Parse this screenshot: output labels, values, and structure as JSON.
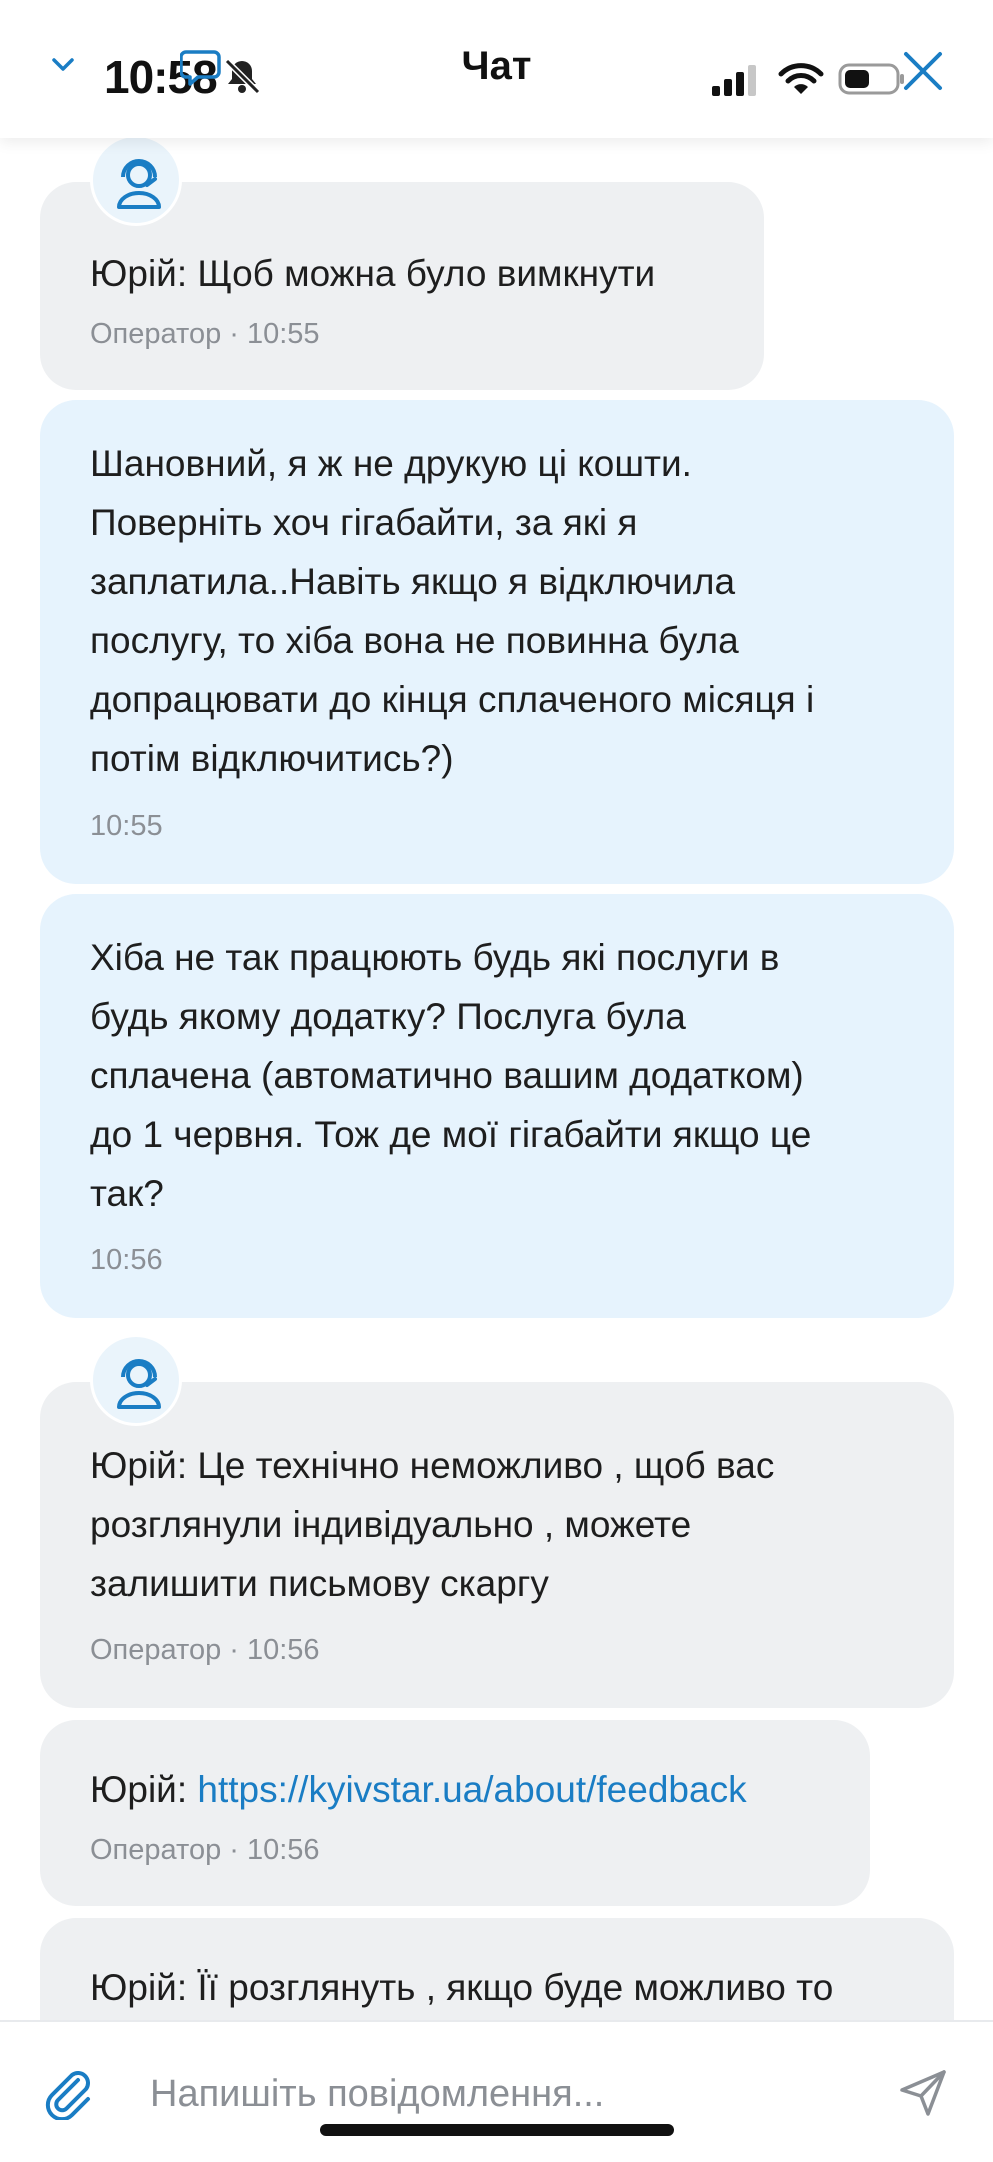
{
  "status_bar": {
    "time": "10:58"
  },
  "header": {
    "title": "Чат"
  },
  "messages": [
    {
      "kind": "operator",
      "author": "Юрій:",
      "text": "Щоб можна було вимкнути",
      "meta": "Оператор · 10:55"
    },
    {
      "kind": "user",
      "lines": [
        "Шановний, я ж не друкую ці кошти.",
        "Поверніть хоч гігабайти, за які я",
        "заплатила..Навіть якщо я відключила",
        "послугу, то хіба вона не повинна була",
        "допрацювати до кінця сплаченого місяця і",
        "потім відключитись?)"
      ],
      "meta": "10:55"
    },
    {
      "kind": "user",
      "lines": [
        "Хіба не так працюють будь які послуги в",
        "будь якому додатку? Послуга була",
        "сплачена (автоматично вашим додатком)",
        "до 1 червня. Тож де мої гігабайти якщо це",
        "так?"
      ],
      "meta": "10:56"
    },
    {
      "kind": "operator",
      "author": "Юрій:",
      "lines": [
        "Юрій: Це технічно неможливо , щоб вас",
        "розглянули індивідуально , можете",
        "залишити письмову скаргу"
      ],
      "meta": "Оператор · 10:56"
    },
    {
      "kind": "operator",
      "author": "Юрій:",
      "link": "https://kyivstar.ua/about/feedback",
      "meta": "Оператор · 10:56"
    },
    {
      "kind": "operator",
      "author": "Юрій:",
      "text": "Юрій: Її розглянуть , якщо буде можливо то"
    }
  ],
  "composer": {
    "placeholder": "Напишіть повідомлення..."
  },
  "colors": {
    "accent": "#1a7dc4",
    "operator_bubble": "#eef0f2",
    "user_bubble": "#e6f3fd"
  }
}
